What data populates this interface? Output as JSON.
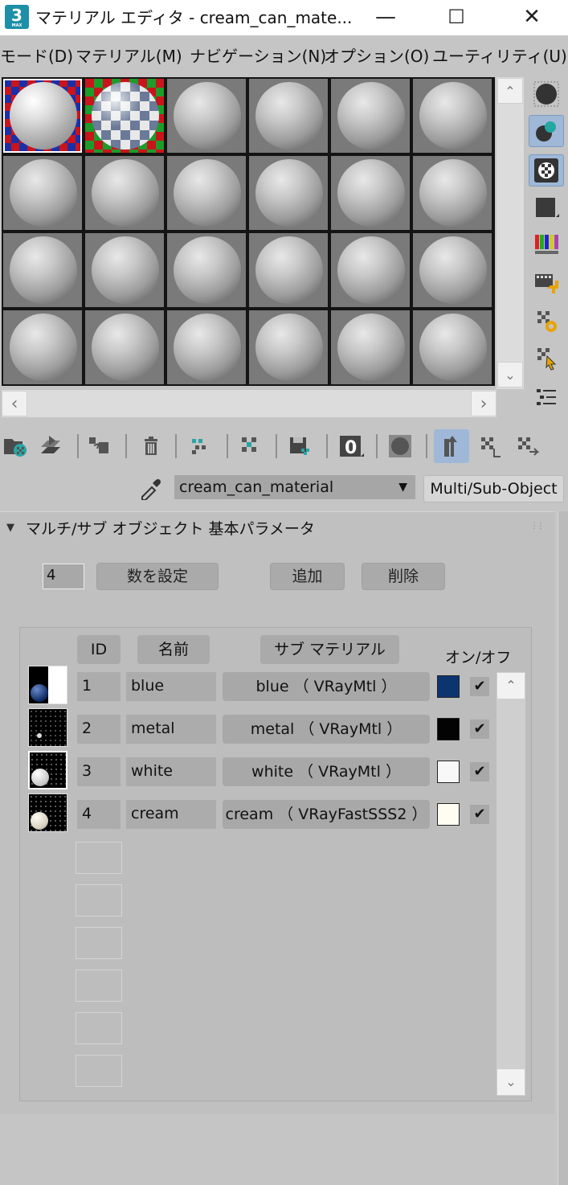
{
  "window": {
    "title": "マテリアル エディタ - cream_can_mate...",
    "minimize": "—",
    "maximize": "☐",
    "close": "✕",
    "app_icon": "3",
    "app_icon_sub": "MAX"
  },
  "menu": [
    "モード(D)",
    "マテリアル(M)",
    "ナビゲーション(N)",
    "オプション(O)",
    "ユーティリティ(U)"
  ],
  "material": {
    "name": "cream_can_material",
    "type": "Multi/Sub-Object"
  },
  "rollout": {
    "title": "マルチ/サブ オブジェクト 基本パラメータ",
    "count": "4",
    "set_count_label": "数を設定",
    "add_label": "追加",
    "delete_label": "削除",
    "headers": {
      "id": "ID",
      "name": "名前",
      "sub": "サブ マテリアル",
      "onoff": "オン/オフ"
    },
    "rows": [
      {
        "id": "1",
        "name": "blue",
        "sub": "blue （ VRayMtl ）",
        "color": "#0c3570",
        "on": "✔"
      },
      {
        "id": "2",
        "name": "metal",
        "sub": "metal （ VRayMtl ）",
        "color": "#030303",
        "on": "✔"
      },
      {
        "id": "3",
        "name": "white",
        "sub": "white （ VRayMtl ）",
        "color": "#f8f8f8",
        "on": "✔"
      },
      {
        "id": "4",
        "name": "cream",
        "sub": "cream （ VRayFastSSS2 ）",
        "color": "#fffcf2",
        "on": "✔"
      }
    ]
  },
  "icons": {
    "collapse": "▼",
    "dropdown": "▼",
    "up": "⌃",
    "down": "⌄",
    "left": "‹",
    "right": "›",
    "grip": "⋮⋮",
    "eyedropper": "eyedropper-icon"
  }
}
